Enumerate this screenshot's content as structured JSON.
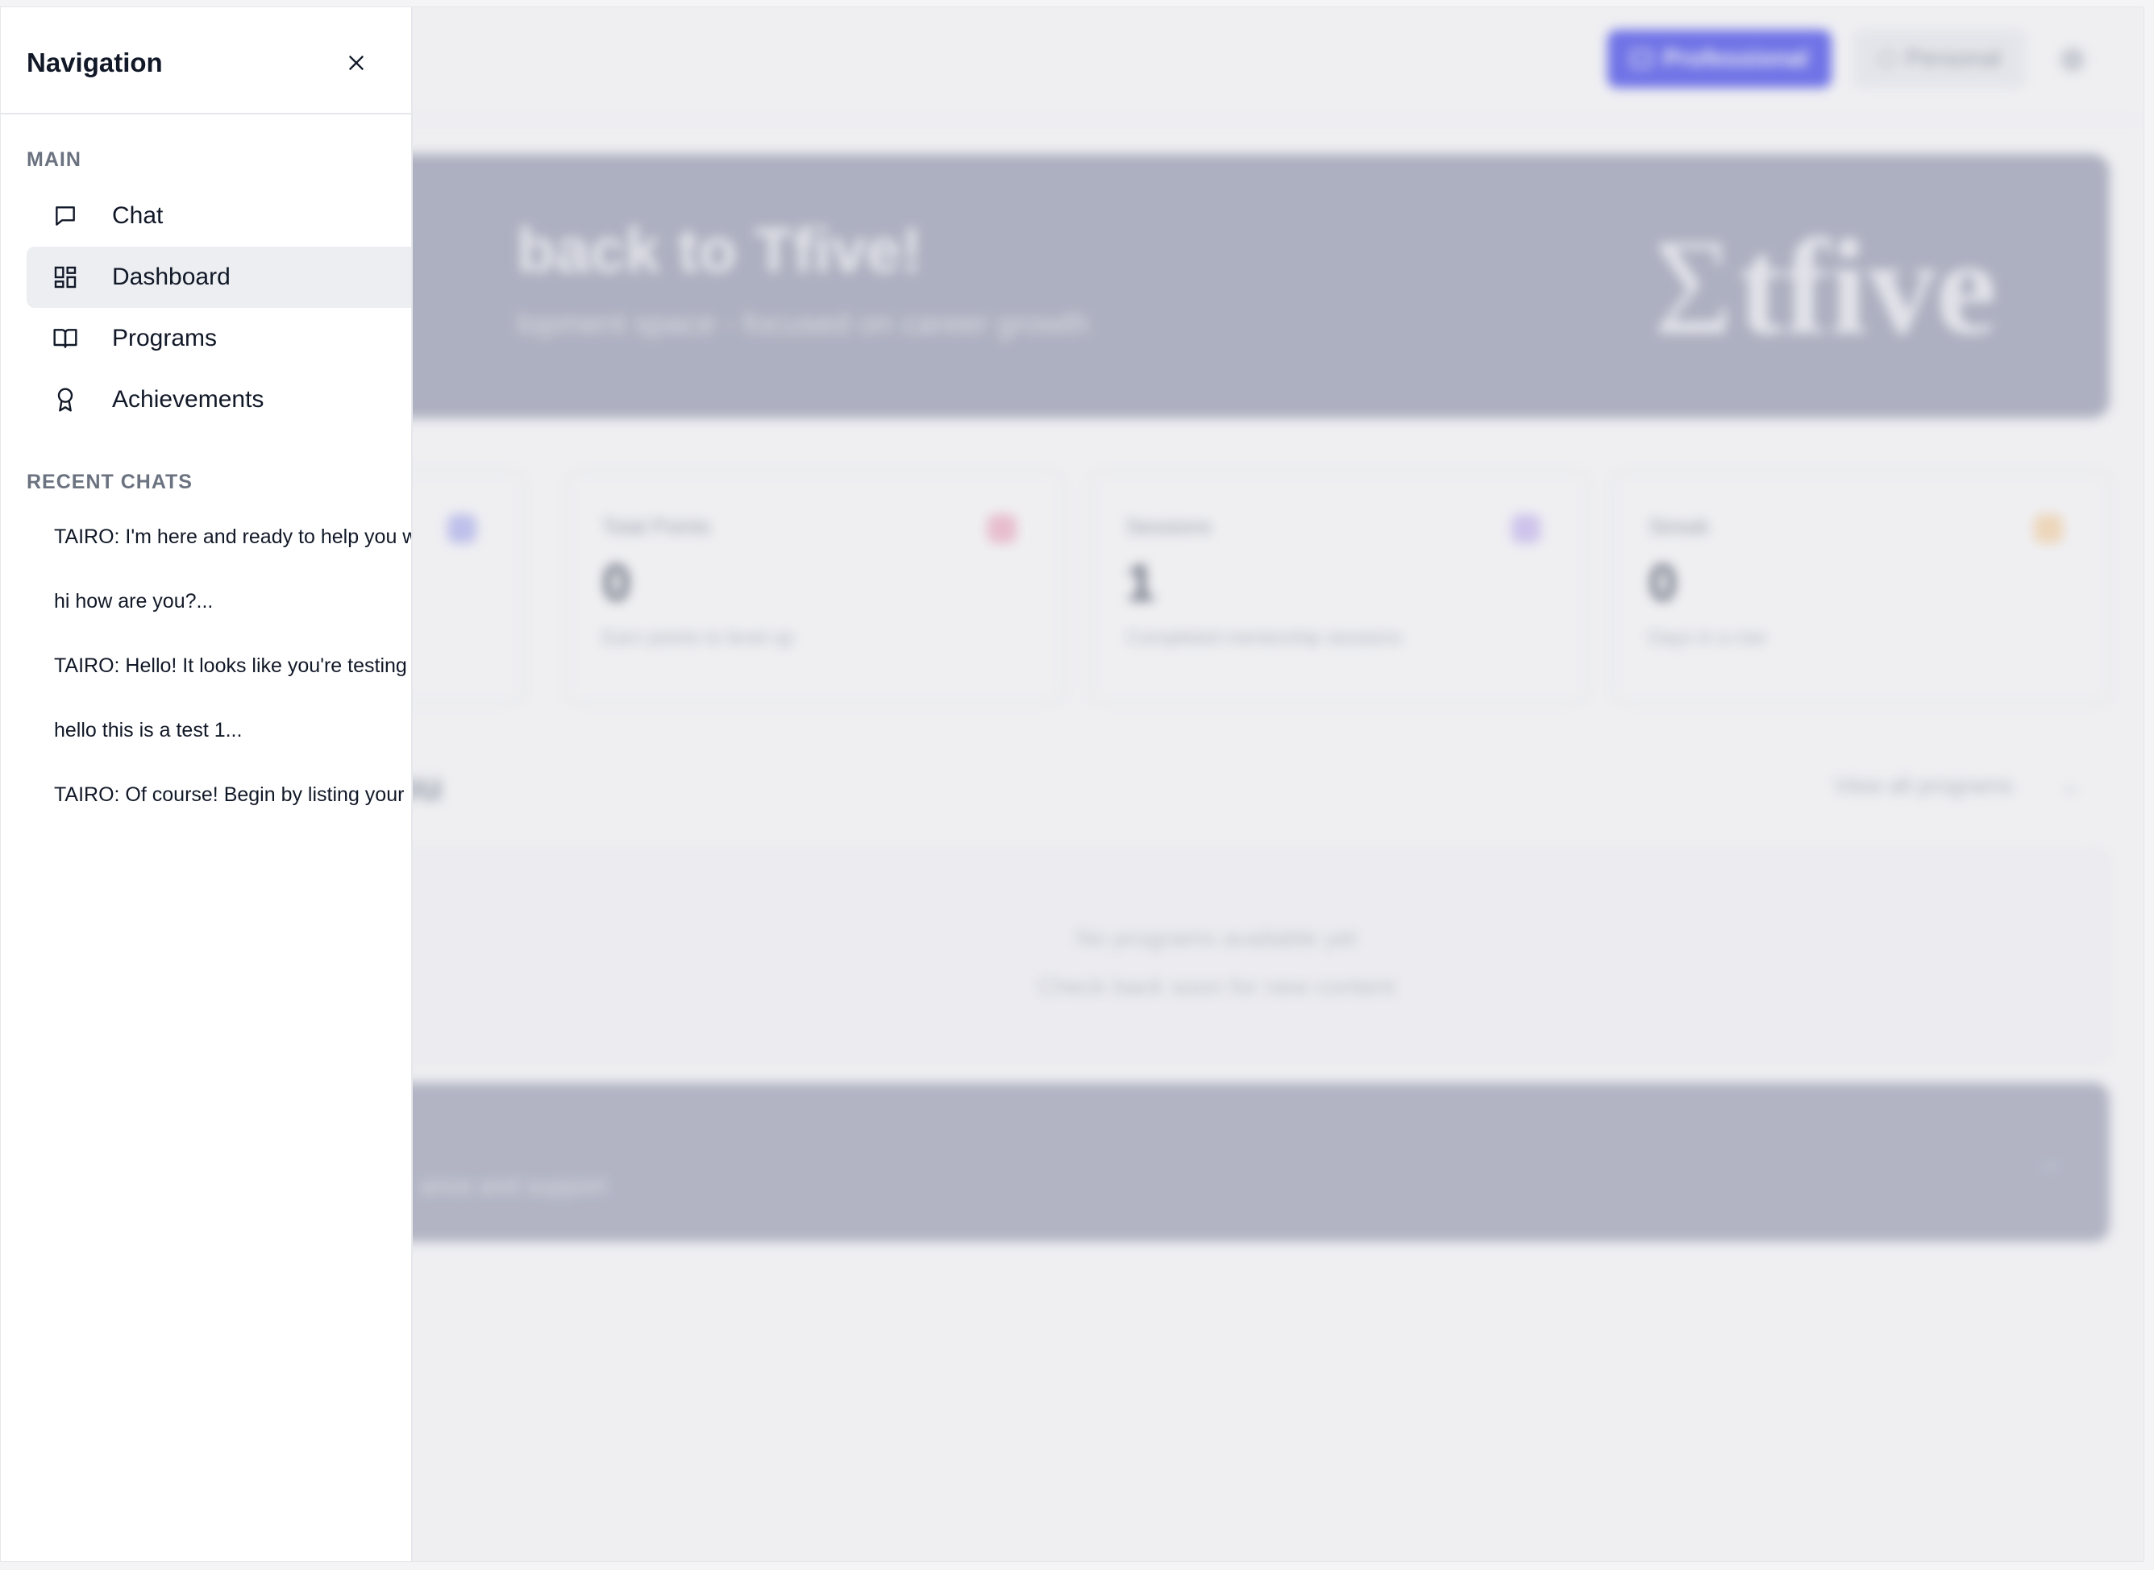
{
  "drawer": {
    "title": "Navigation",
    "main_label": "MAIN",
    "items": [
      {
        "label": "Chat",
        "icon": "chat-icon"
      },
      {
        "label": "Dashboard",
        "icon": "dashboard-icon",
        "active": true
      },
      {
        "label": "Programs",
        "icon": "book-icon"
      },
      {
        "label": "Achievements",
        "icon": "award-icon"
      }
    ],
    "recent_label": "RECENT CHATS",
    "recent_chats": [
      "TAIRO: I'm here and ready to help you w",
      "hi how are you?...",
      "TAIRO: Hello! It looks like you're testing",
      "hello this is a test 1...",
      "TAIRO: Of course! Begin by listing your"
    ]
  },
  "background": {
    "topbar": {
      "primary_button": "Professional",
      "secondary_button": "Personal"
    },
    "hero": {
      "title": "back to Tfive!",
      "subtitle": "lopment space - focused on career growth",
      "logo_text": "tfive"
    },
    "stats": [
      {
        "label": "Total Points",
        "value": "0",
        "note": "Earn points to level up"
      },
      {
        "label": "Sessions",
        "value": "1",
        "note": "Completed mentorship sessions"
      },
      {
        "label": "Streak",
        "value": "0",
        "note": "Days in a row"
      }
    ],
    "programs_section": {
      "title": "or You",
      "view_all": "View all programs",
      "empty_line_1": "No programs available yet",
      "empty_line_2": "Check back soon for new content"
    },
    "support": {
      "text": "ance and support"
    }
  },
  "colors": {
    "accent": "#6b6ff2",
    "active_bg": "#eceef2",
    "hero_bg": "#b3b6c6"
  }
}
